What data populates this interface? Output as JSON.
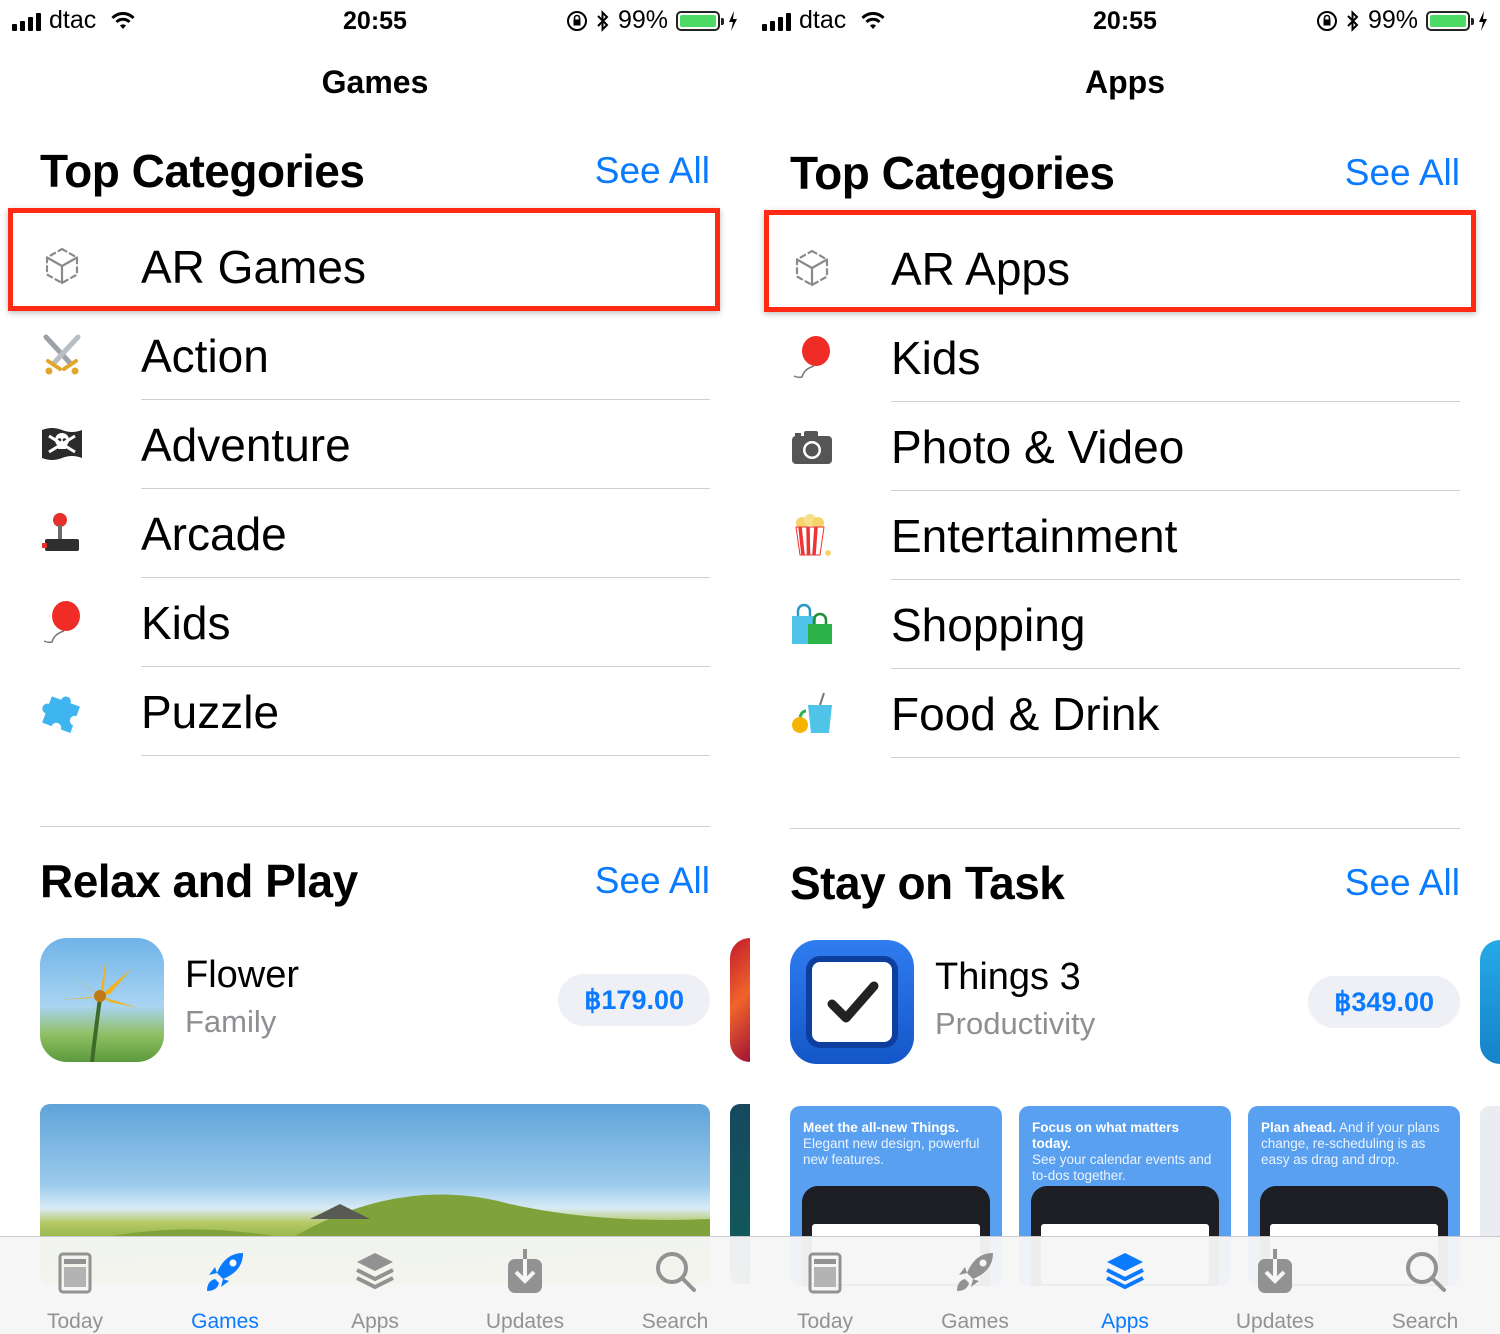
{
  "status": {
    "carrier": "dtac",
    "time": "20:55",
    "battery": "99%"
  },
  "colors": {
    "accent": "#0a7aff",
    "highlight": "#ff2a14",
    "inactive_tab": "#929292"
  },
  "left": {
    "nav_title": "Games",
    "top_categories": {
      "title": "Top Categories",
      "see_all": "See All",
      "items": [
        {
          "label": "AR Games",
          "icon": "ar-cube-icon"
        },
        {
          "label": "Action",
          "icon": "crossed-swords-icon"
        },
        {
          "label": "Adventure",
          "icon": "pirate-flag-icon"
        },
        {
          "label": "Arcade",
          "icon": "joystick-icon"
        },
        {
          "label": "Kids",
          "icon": "balloon-icon"
        },
        {
          "label": "Puzzle",
          "icon": "puzzle-piece-icon"
        }
      ]
    },
    "featured": {
      "title": "Relax and Play",
      "see_all": "See All",
      "app": {
        "name": "Flower",
        "category": "Family",
        "price": "฿179.00"
      }
    }
  },
  "right": {
    "nav_title": "Apps",
    "top_categories": {
      "title": "Top Categories",
      "see_all": "See All",
      "items": [
        {
          "label": "AR Apps",
          "icon": "ar-cube-icon"
        },
        {
          "label": "Kids",
          "icon": "balloon-icon"
        },
        {
          "label": "Photo & Video",
          "icon": "camera-icon"
        },
        {
          "label": "Entertainment",
          "icon": "popcorn-icon"
        },
        {
          "label": "Shopping",
          "icon": "shopping-bags-icon"
        },
        {
          "label": "Food & Drink",
          "icon": "drink-icon"
        }
      ]
    },
    "featured": {
      "title": "Stay on Task",
      "see_all": "See All",
      "app": {
        "name": "Things 3",
        "category": "Productivity",
        "price": "฿349.00"
      },
      "screenshots": [
        {
          "bold": "Meet the all-new Things.",
          "text": "Elegant new design, powerful new features."
        },
        {
          "bold": "Focus on what matters today.",
          "text": "See your calendar events and to-dos together."
        },
        {
          "bold": "Plan ahead.",
          "text": "And if your plans change, re-scheduling is as easy as drag and drop."
        }
      ]
    }
  },
  "tabs": [
    {
      "label": "Today",
      "icon": "today-icon"
    },
    {
      "label": "Games",
      "icon": "rocket-icon"
    },
    {
      "label": "Apps",
      "icon": "apps-stack-icon"
    },
    {
      "label": "Updates",
      "icon": "updates-icon"
    },
    {
      "label": "Search",
      "icon": "search-icon"
    }
  ],
  "active_tab": {
    "left": "Games",
    "right": "Apps"
  }
}
